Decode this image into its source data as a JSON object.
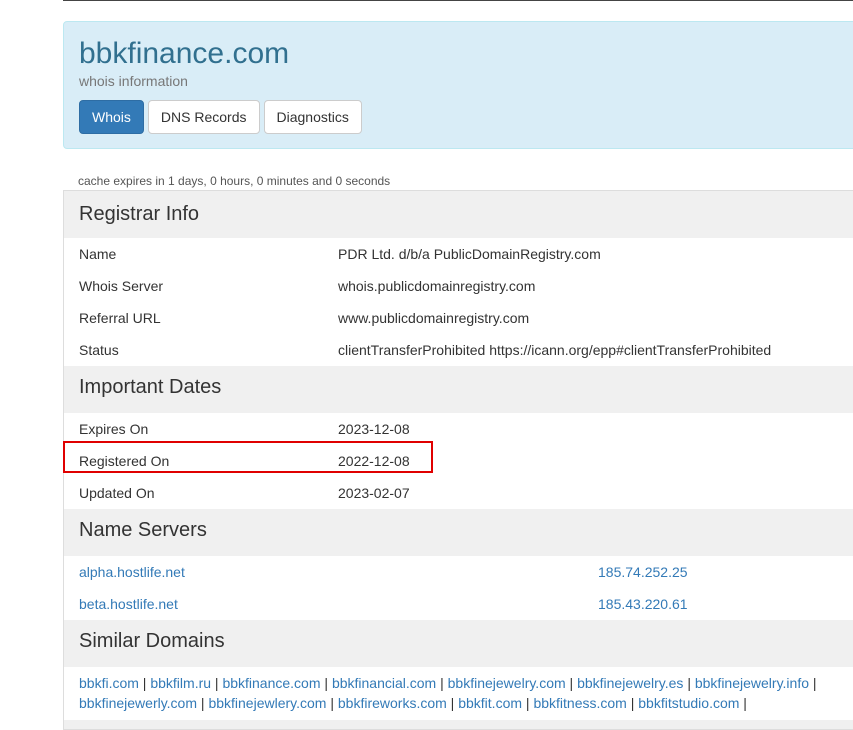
{
  "header": {
    "domain": "bbkfinance.com",
    "subtitle": "whois information",
    "tabs": [
      "Whois",
      "DNS Records",
      "Diagnostics"
    ]
  },
  "cache_note": "cache expires in 1 days, 0 hours, 0 minutes and 0 seconds",
  "registrar": {
    "title": "Registrar Info",
    "rows": [
      {
        "key": "Name",
        "value": "PDR Ltd. d/b/a PublicDomainRegistry.com"
      },
      {
        "key": "Whois Server",
        "value": "whois.publicdomainregistry.com"
      },
      {
        "key": "Referral URL",
        "value": "www.publicdomainregistry.com"
      },
      {
        "key": "Status",
        "value": "clientTransferProhibited https://icann.org/epp#clientTransferProhibited"
      }
    ]
  },
  "dates": {
    "title": "Important Dates",
    "rows": [
      {
        "key": "Expires On",
        "value": "2023-12-08"
      },
      {
        "key": "Registered On",
        "value": "2022-12-08"
      },
      {
        "key": "Updated On",
        "value": "2023-02-07"
      }
    ]
  },
  "nameservers": {
    "title": "Name Servers",
    "rows": [
      {
        "host": "alpha.hostlife.net",
        "ip": "185.74.252.25"
      },
      {
        "host": "beta.hostlife.net",
        "ip": "185.43.220.61"
      }
    ]
  },
  "similar": {
    "title": "Similar Domains",
    "line1": [
      "bbkfi.com",
      "bbkfilm.ru",
      "bbkfinance.com",
      "bbkfinancial.com",
      "bbkfinejewelry.com",
      "bbkfinejewelry.es",
      "bbkfinejewelry.info"
    ],
    "line2": [
      "bbkfinejewerly.com",
      "bbkfinejewlery.com",
      "bbkfireworks.com",
      "bbkfit.com",
      "bbkfitness.com",
      "bbkfitstudio.com"
    ],
    "separator": "|"
  },
  "colors": {
    "accent": "#337ab7",
    "highlight": "#e00000",
    "jumbotron": "#d9edf7"
  }
}
